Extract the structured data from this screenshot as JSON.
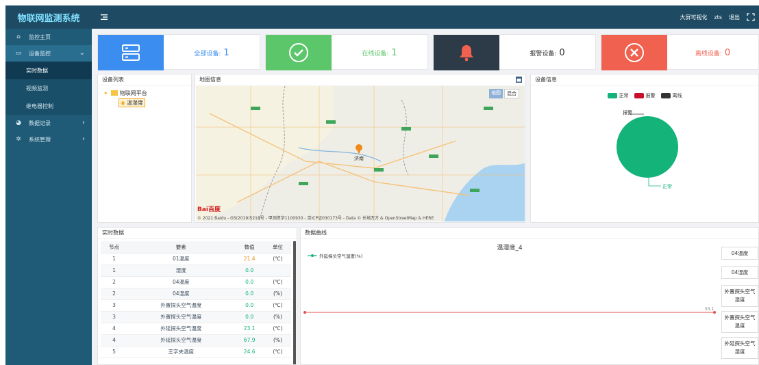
{
  "app": {
    "title": "物联网监测系统"
  },
  "topbar": {
    "links": [
      "大屏可视化",
      "zts",
      "退出"
    ]
  },
  "sidebar": {
    "items": [
      {
        "label": "监控主页",
        "icon": "home-icon"
      },
      {
        "label": "设备监控",
        "icon": "monitor-icon",
        "expanded": true,
        "children": [
          {
            "label": "实时数据"
          },
          {
            "label": "视频监测"
          },
          {
            "label": "继电器控制"
          }
        ]
      },
      {
        "label": "数据记录",
        "icon": "pie-icon"
      },
      {
        "label": "系统管理",
        "icon": "gear-icon"
      }
    ]
  },
  "stats": [
    {
      "label": "全部设备:",
      "value": "1",
      "color": "#3b8ef0",
      "icon": "server-icon"
    },
    {
      "label": "在线设备:",
      "value": "1",
      "color": "#5cc66b",
      "icon": "check-icon"
    },
    {
      "label": "报警设备:",
      "value": "0",
      "color": "#2d3a48",
      "icon": "bell-icon"
    },
    {
      "label": "离线设备:",
      "value": "0",
      "color": "#f0614f",
      "icon": "close-icon"
    }
  ],
  "device_list": {
    "title": "设备列表",
    "root": "物联网平台",
    "child": "温湿度"
  },
  "map": {
    "title": "地图信息",
    "buttons": [
      "地图",
      "混合"
    ],
    "city": "济南",
    "copyright": "© 2021 Baidu - GS(2019)5218号 - 甲测资字1100930 - 京ICP证030173号 - Data © 长地万方 & OpenStreetMap & HERE",
    "logo": "Bai百度"
  },
  "device_info": {
    "title": "设备信息",
    "legend": [
      "正常",
      "报警",
      "离线"
    ],
    "legend_colors": [
      "#14b37a",
      "#c8102e",
      "#333333"
    ],
    "label_top": "报警",
    "label_bottom": "正常",
    "chart_data": {
      "type": "pie",
      "categories": [
        "正常",
        "报警",
        "离线"
      ],
      "values": [
        1,
        0,
        0
      ]
    }
  },
  "realtime": {
    "title": "实时数据",
    "columns": [
      "节点",
      "要素",
      "数值",
      "单位"
    ],
    "rows": [
      [
        "1",
        "01温度",
        "21.4",
        "(℃)"
      ],
      [
        "1",
        "湿度",
        "0.0",
        ""
      ],
      [
        "2",
        "04温度",
        "0.0",
        "(℃)"
      ],
      [
        "2",
        "04湿度",
        "0.0",
        "(%)"
      ],
      [
        "3",
        "外置探头空气温度",
        "0.0",
        "(℃)"
      ],
      [
        "3",
        "外置探头空气湿度",
        "0.0",
        "(%)"
      ],
      [
        "4",
        "外延探头空气温度",
        "23.1",
        "(℃)"
      ],
      [
        "4",
        "外延探头空气湿度",
        "67.9",
        "(%)"
      ],
      [
        "5",
        "王字夹温度",
        "24.6",
        "(℃)"
      ]
    ]
  },
  "curve": {
    "title": "数据曲线",
    "chart_title": "温湿度_4",
    "series_name": "外延探头空气湿度(%)",
    "end_label": "53.1",
    "buttons": [
      "04温度",
      "04湿度",
      "外置探头空气湿度",
      "外置探头空气温度",
      "外延探头空气湿度"
    ],
    "chart_data": {
      "type": "line",
      "series": [
        {
          "name": "外延探头空气湿度(%)",
          "values": [
            53.1,
            53.1
          ]
        }
      ]
    }
  }
}
